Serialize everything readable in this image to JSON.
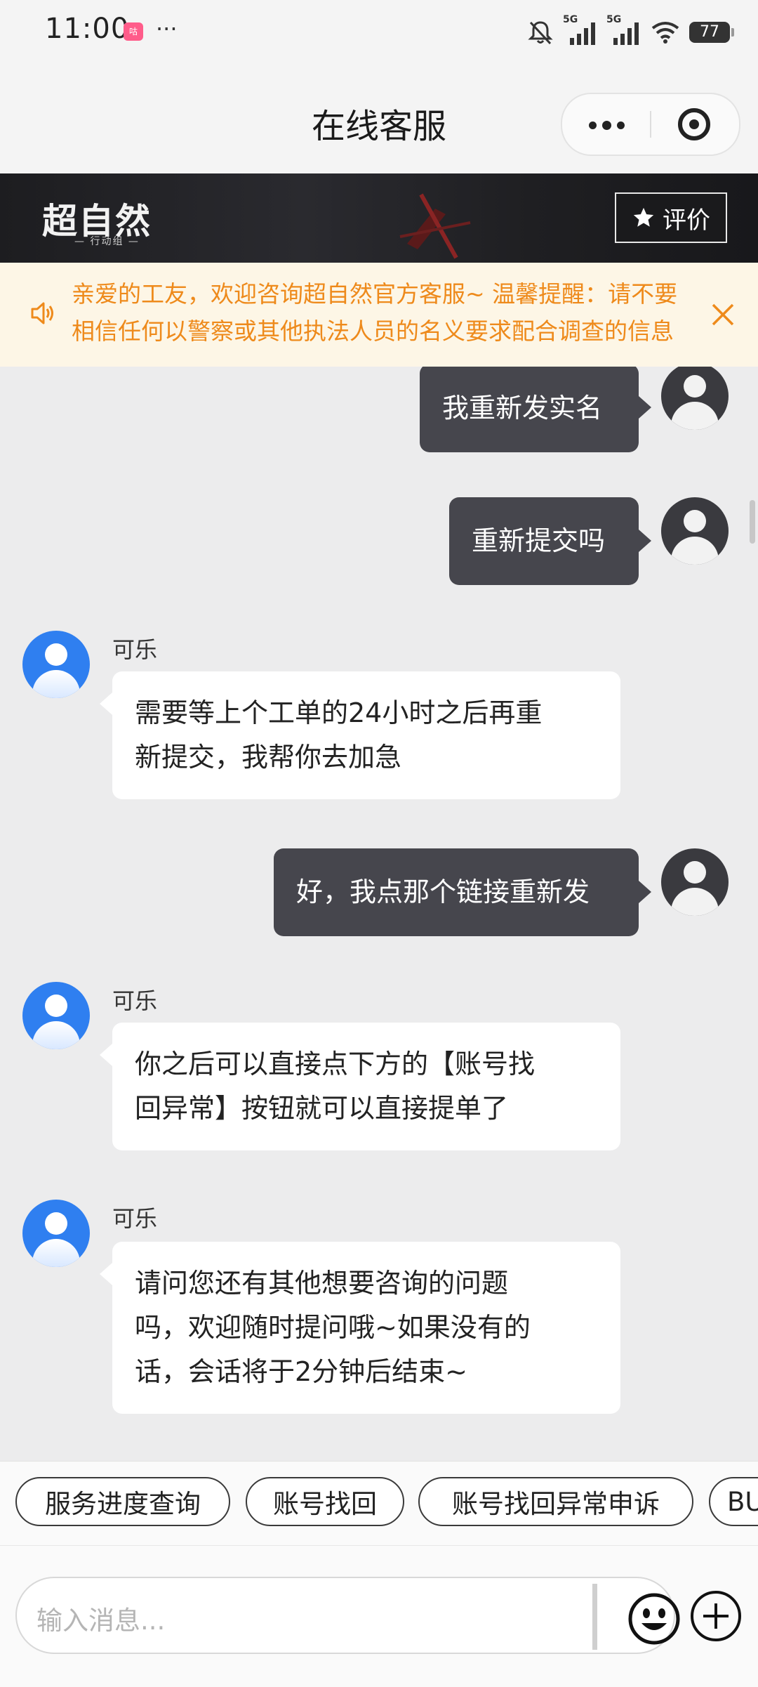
{
  "status_bar": {
    "time": "11:00",
    "dots": "···",
    "app_badge": "咕",
    "battery": "77",
    "network_1": "5G",
    "network_2": "5G"
  },
  "nav": {
    "title": "在线客服"
  },
  "banner": {
    "logo": "超自然",
    "logo_sub": "— 行动组 —",
    "rate_label": "评价"
  },
  "notice": {
    "text": "亲爱的工友，欢迎咨询超自然官方客服~ 温馨提醒：请不要相信任何以警察或其他执法人员的名义要求配合调查的信息"
  },
  "chat": {
    "messages": [
      {
        "from": "user",
        "text": "我重新发实名"
      },
      {
        "from": "user",
        "text": "重新提交吗"
      },
      {
        "from": "agent",
        "name": "可乐",
        "lines": [
          "需要等上个工单的24小时之后再重",
          "新提交，我帮你去加急"
        ]
      },
      {
        "from": "user",
        "text": "好，我点那个链接重新发"
      },
      {
        "from": "agent",
        "name": "可乐",
        "lines": [
          "你之后可以直接点下方的【账号找",
          "回异常】按钮就可以直接提单了"
        ]
      },
      {
        "from": "agent",
        "name": "可乐",
        "lines": [
          "请问您还有其他想要咨询的问题",
          "吗，欢迎随时提问哦~如果没有的",
          "话，会话将于2分钟后结束~"
        ]
      }
    ]
  },
  "quick_replies": [
    "服务进度查询",
    "账号找回",
    "账号找回异常申诉",
    "BU"
  ],
  "input": {
    "placeholder": "输入消息..."
  },
  "colors": {
    "notice_text": "#ee8a1b",
    "notice_bg": "#fdf6e6",
    "user_bubble": "#46464d",
    "agent_avatar": "#2f7ff0",
    "chat_bg": "#ececed"
  },
  "icons": [
    "mute-icon",
    "signal-icon",
    "wifi-icon",
    "battery-icon",
    "more-icon",
    "close-miniprogram-icon",
    "star-icon",
    "speaker-icon",
    "close-icon",
    "emoji-icon",
    "plus-icon"
  ]
}
